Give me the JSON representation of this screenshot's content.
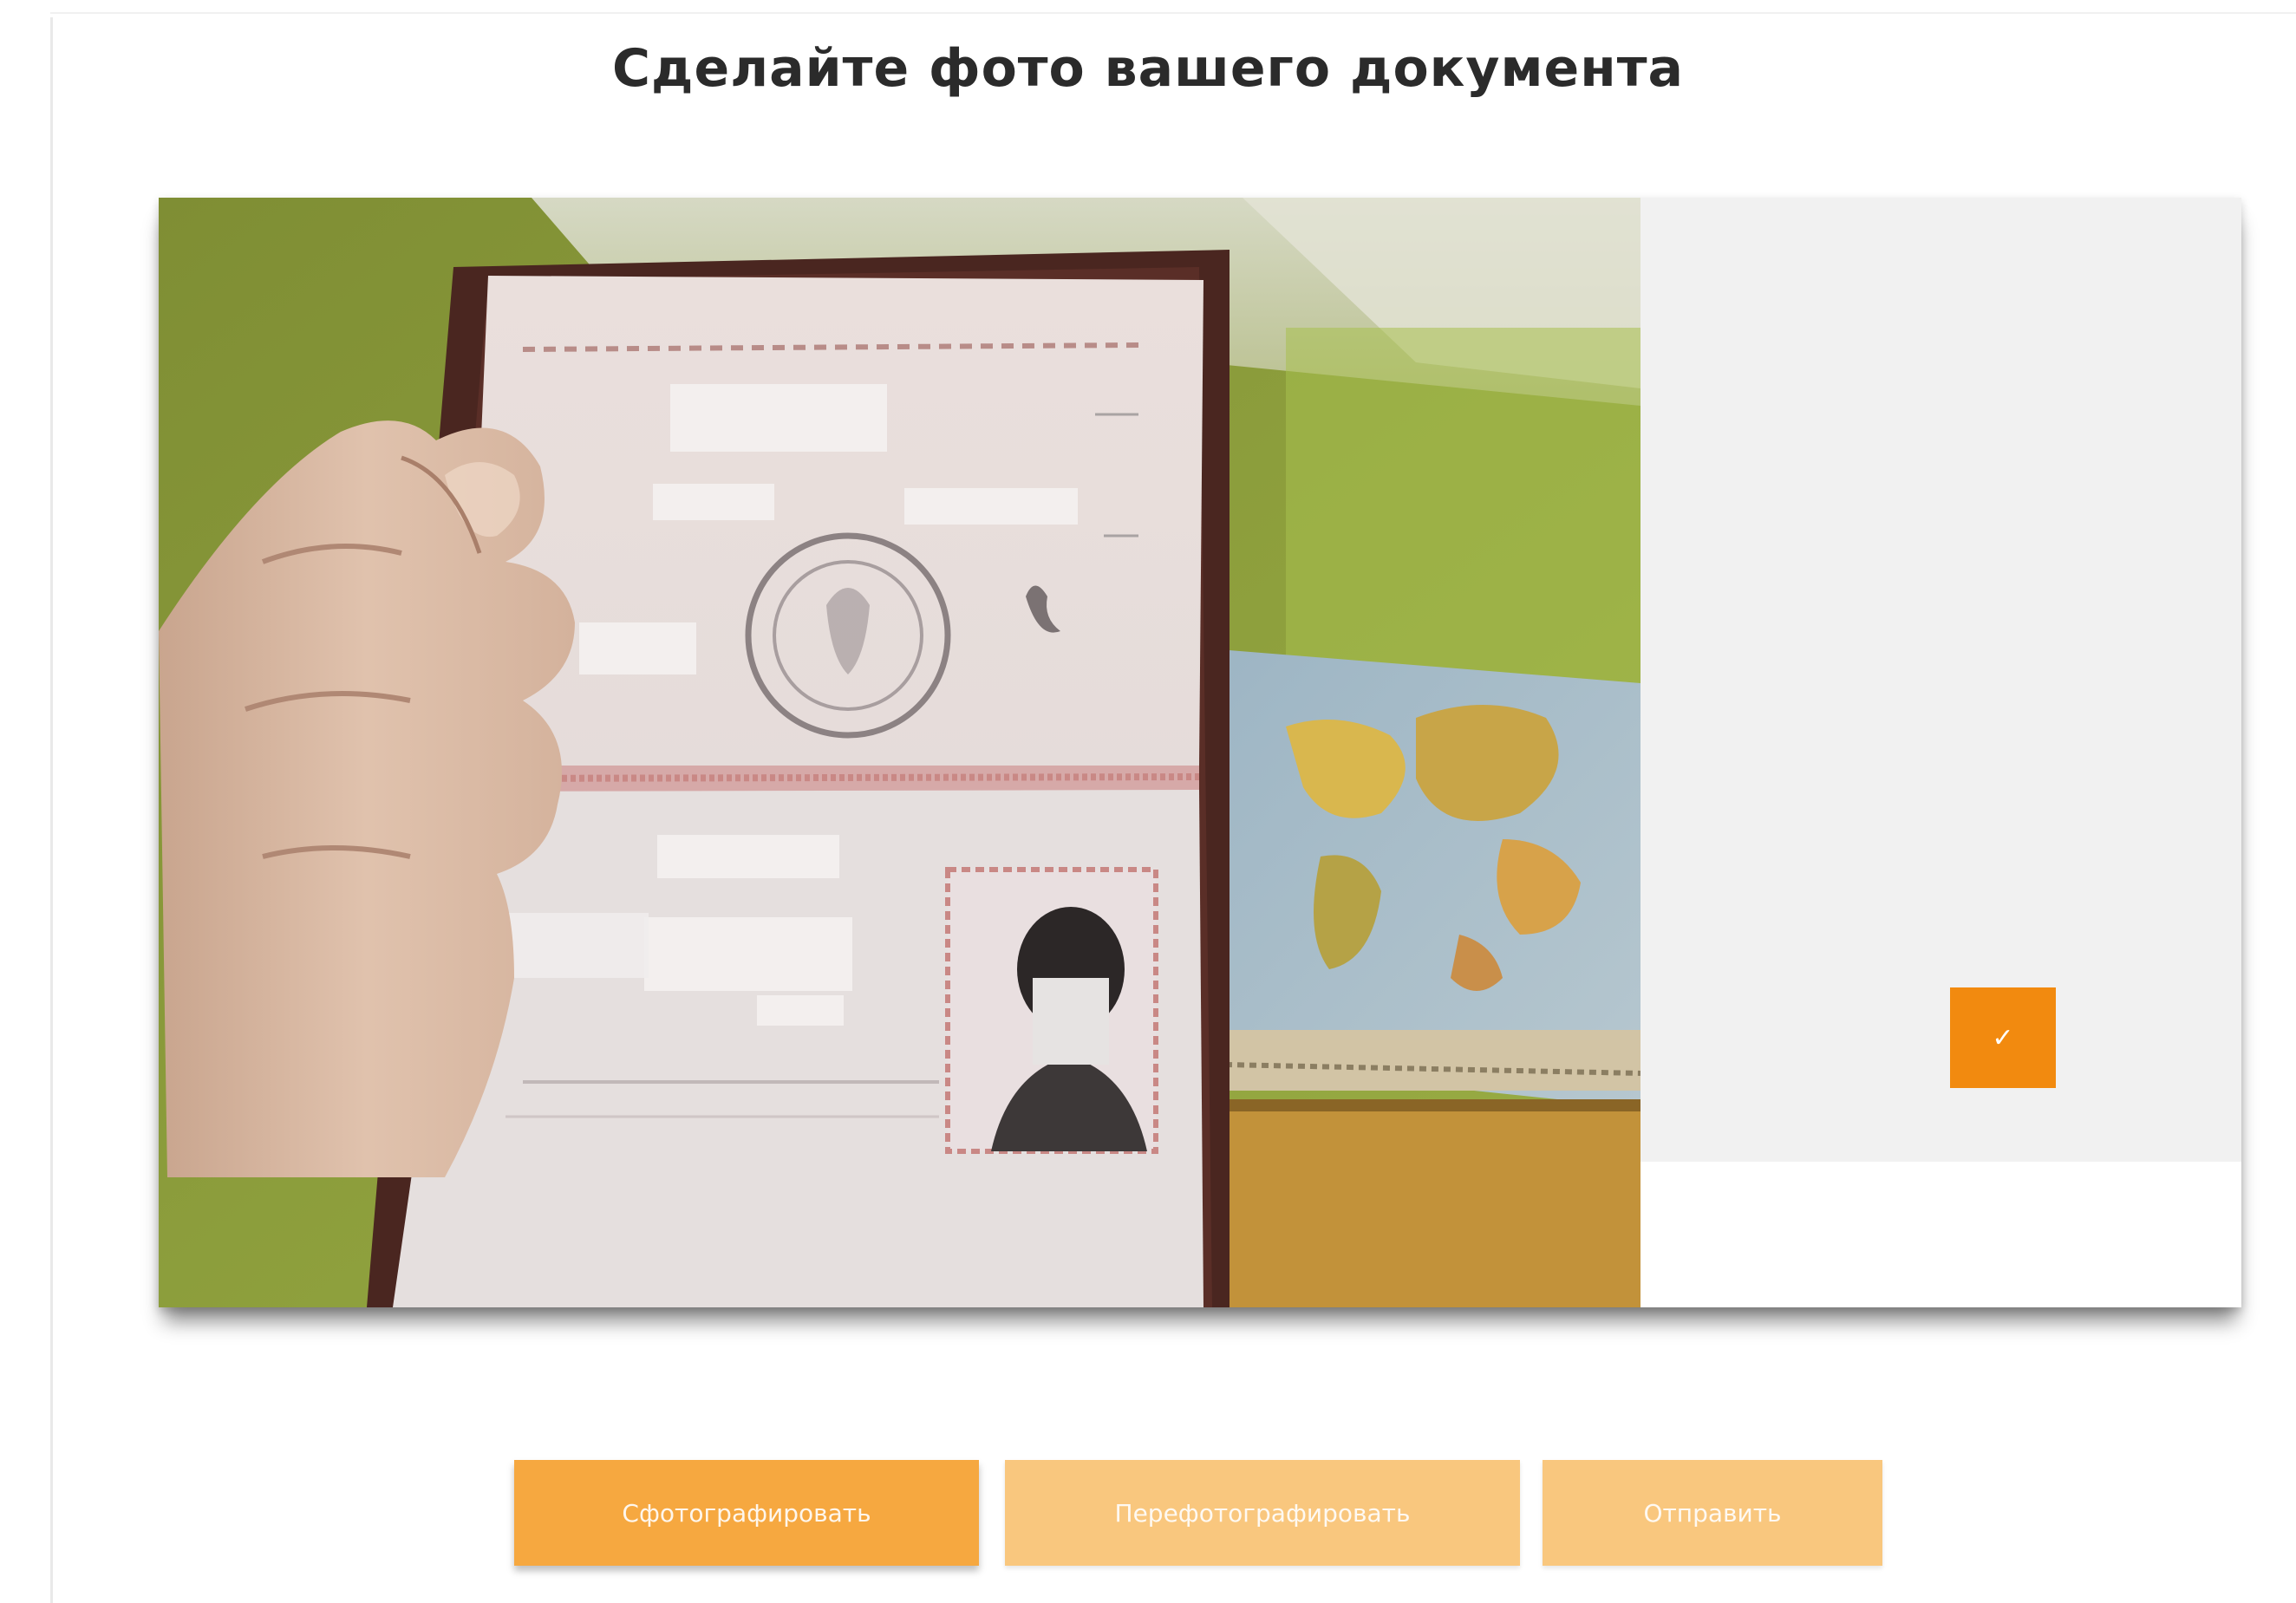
{
  "page": {
    "title": "Сделайте фото вашего документа"
  },
  "camera": {
    "feed_icon": "camera-feed",
    "confirm_icon": "checkmark-icon",
    "confirm_glyph": "✓"
  },
  "actions": {
    "take_photo_label": "Сфотографировать",
    "retake_label": "Перефотографировать",
    "send_label": "Отправить"
  },
  "colors": {
    "accent": "#f28a0f",
    "button_active": "#f6a840",
    "button_disabled": "#f9c77e",
    "preview_bg": "#f1f1f1"
  }
}
